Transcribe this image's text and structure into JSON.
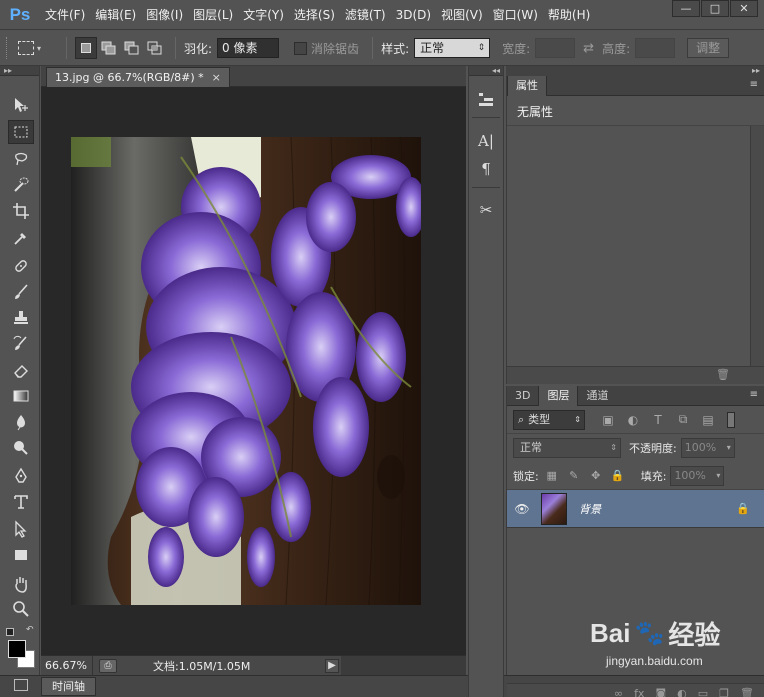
{
  "app": {
    "logo": "Ps",
    "menu": [
      "文件(F)",
      "编辑(E)",
      "图像(I)",
      "图层(L)",
      "文字(Y)",
      "选择(S)",
      "滤镜(T)",
      "3D(D)",
      "视图(V)",
      "窗口(W)",
      "帮助(H)"
    ],
    "window_controls": {
      "minimize": "—",
      "restore": "□",
      "close": "✕"
    }
  },
  "options": {
    "feather_label": "羽化:",
    "feather_value": "0 像素",
    "antialias_label": "消除锯齿",
    "style_label": "样式:",
    "style_value": "正常",
    "width_label": "宽度:",
    "height_label": "高度:",
    "refine_button": "调整"
  },
  "document": {
    "tab_title": "13.jpg @ 66.7%(RGB/8#) *",
    "tab_close": "×",
    "zoom": "66.67%",
    "doc_size": "文档:1.05M/1.05M"
  },
  "timeline": {
    "tab": "时间轴"
  },
  "properties": {
    "tab": "属性",
    "empty_text": "无属性"
  },
  "layers": {
    "tabs": [
      "3D",
      "图层",
      "通道"
    ],
    "active_tab": 1,
    "kind_label": "类型",
    "blend_mode": "正常",
    "opacity_label": "不透明度:",
    "opacity_value": "100%",
    "lock_label": "锁定:",
    "fill_label": "填充:",
    "fill_value": "100%",
    "items": [
      {
        "name": "背景",
        "visible": true,
        "locked": true
      }
    ]
  },
  "colors": {
    "foreground": "#000000",
    "background": "#ffffff",
    "selected_layer": "#5f7490"
  },
  "watermark": {
    "brand": "Bai",
    "brand_suffix": "经验",
    "url": "jingyan.baidu.com"
  }
}
